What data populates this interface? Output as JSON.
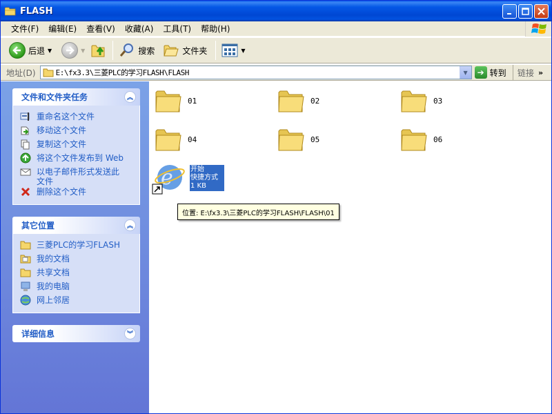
{
  "window": {
    "title": "FLASH"
  },
  "menubar": {
    "items": [
      "文件(F)",
      "编辑(E)",
      "查看(V)",
      "收藏(A)",
      "工具(T)",
      "帮助(H)"
    ]
  },
  "toolbar": {
    "back_label": "后退",
    "search_label": "搜索",
    "folders_label": "文件夹"
  },
  "address": {
    "label": "地址(D)",
    "value": "E:\\fx3.3\\三菱PLC的学习FLASH\\FLASH",
    "go_label": "转到",
    "links_label": "链接"
  },
  "tasks_panel": {
    "title": "文件和文件夹任务",
    "items": [
      {
        "label": "重命名这个文件",
        "icon": "rename-icon"
      },
      {
        "label": "移动这个文件",
        "icon": "move-icon"
      },
      {
        "label": "复制这个文件",
        "icon": "copy-icon"
      },
      {
        "label": "将这个文件发布到 Web",
        "icon": "publish-web-icon"
      },
      {
        "label": "以电子邮件形式发送此文件",
        "icon": "email-icon"
      },
      {
        "label": "删除这个文件",
        "icon": "delete-icon"
      }
    ]
  },
  "places_panel": {
    "title": "其它位置",
    "items": [
      {
        "label": "三菱PLC的学习FLASH",
        "icon": "folder-icon"
      },
      {
        "label": "我的文档",
        "icon": "my-documents-icon"
      },
      {
        "label": "共享文档",
        "icon": "folder-icon"
      },
      {
        "label": "我的电脑",
        "icon": "my-computer-icon"
      },
      {
        "label": "网上邻居",
        "icon": "network-icon"
      }
    ]
  },
  "details_panel": {
    "title": "详细信息"
  },
  "folders": [
    "01",
    "02",
    "03",
    "04",
    "05",
    "06"
  ],
  "shortcut": {
    "line1": "开始",
    "line2": "快捷方式",
    "line3": "1 KB"
  },
  "tooltip": {
    "text": "位置: E:\\fx3.3\\三菱PLC的学习FLASH\\FLASH\\01"
  },
  "colors": {
    "title_bar": "#0054e3",
    "task_link": "#215dc6",
    "selection": "#316ac5",
    "tooltip_bg": "#ffffe1"
  }
}
